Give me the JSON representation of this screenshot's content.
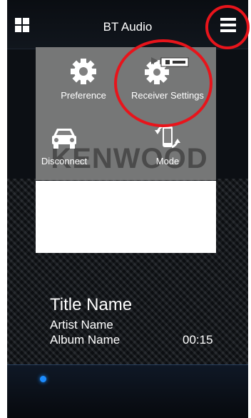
{
  "header": {
    "title": "BT Audio",
    "home_icon": "grid-icon",
    "menu_icon": "hamburger-menu-icon"
  },
  "menu": {
    "items": [
      {
        "label": "Preference",
        "icon": "gear-icon"
      },
      {
        "label": "Receiver Settings",
        "icon": "receiver-gear-icon"
      },
      {
        "label": "Disconnect",
        "icon": "car-icon"
      },
      {
        "label": "Mode",
        "icon": "phone-rotate-icon"
      }
    ]
  },
  "background_logo": "KENWOOD",
  "track": {
    "title": "Title Name",
    "artist": "Artist Name",
    "album": "Album Name",
    "time": "00:15"
  },
  "colors": {
    "highlight": "#e8141b",
    "accent": "#1c8cff"
  }
}
